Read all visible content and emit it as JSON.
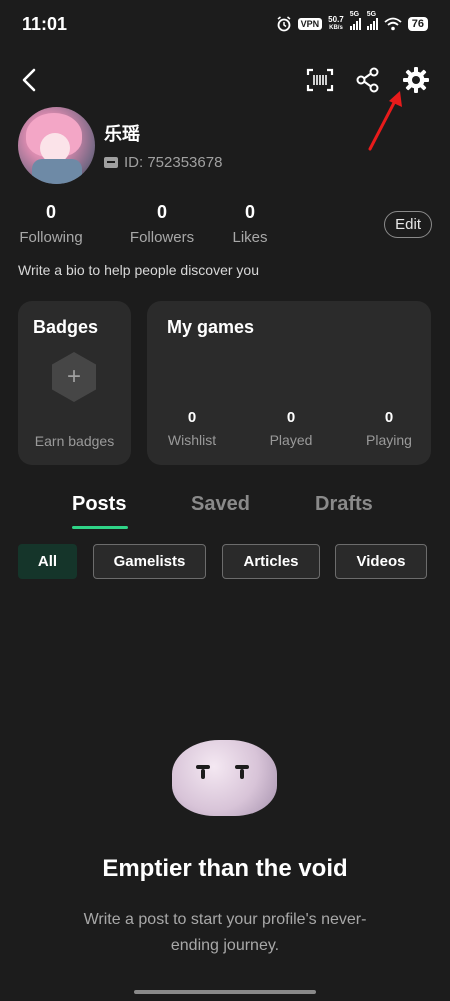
{
  "status_bar": {
    "time": "11:01",
    "vpn": "VPN",
    "net_speed_value": "50.7",
    "net_speed_unit": "KB/s",
    "sig1_tag": "5G",
    "sig2_tag": "5G",
    "battery": "76",
    "icons": [
      "alarm-icon",
      "wifi-icon",
      "signal-icon"
    ]
  },
  "nav": {
    "icons": [
      "back-icon",
      "scan-icon",
      "share-icon",
      "settings-icon"
    ]
  },
  "profile": {
    "username": "乐瑶",
    "id_label": "ID: 752353678"
  },
  "stats": [
    {
      "value": "0",
      "label": "Following"
    },
    {
      "value": "0",
      "label": "Followers"
    },
    {
      "value": "0",
      "label": "Likes"
    }
  ],
  "edit_label": "Edit",
  "bio_placeholder": "Write a bio to help people discover you",
  "badges": {
    "title": "Badges",
    "plus": "+",
    "earn": "Earn badges"
  },
  "games": {
    "title": "My games",
    "stats": [
      {
        "value": "0",
        "label": "Wishlist"
      },
      {
        "value": "0",
        "label": "Played"
      },
      {
        "value": "0",
        "label": "Playing"
      }
    ]
  },
  "tabs": [
    {
      "label": "Posts",
      "active": true
    },
    {
      "label": "Saved",
      "active": false
    },
    {
      "label": "Drafts",
      "active": false
    }
  ],
  "filters": [
    {
      "label": "All",
      "active": true
    },
    {
      "label": "Gamelists",
      "active": false
    },
    {
      "label": "Articles",
      "active": false
    },
    {
      "label": "Videos",
      "active": false
    }
  ],
  "empty": {
    "title": "Emptier than the void",
    "subtitle": "Write a post to start your profile's never-ending journey."
  },
  "colors": {
    "background": "#1c1c1c",
    "card": "#2b2b2b",
    "accent_green": "#2fd487",
    "annotation_red": "#e81b1b"
  }
}
